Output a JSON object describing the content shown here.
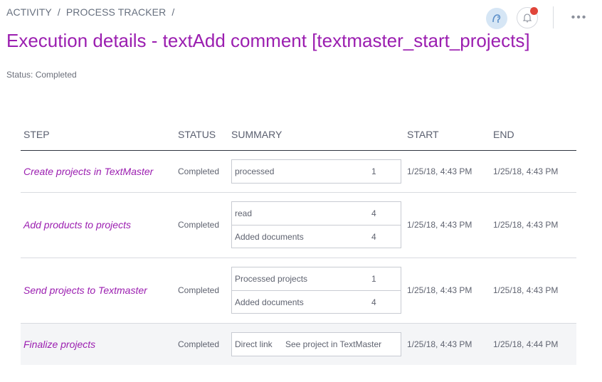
{
  "breadcrumb": {
    "items": [
      "ACTIVITY",
      "/",
      "PROCESS TRACKER",
      "/"
    ]
  },
  "page": {
    "title": "Execution details - textAdd comment [textmaster_start_projects]",
    "status_label": "Status: Completed"
  },
  "topbar": {
    "avatar_icon": "user-avatar-icon",
    "bell_icon": "bell-icon",
    "more_icon": "more-horizontal-icon",
    "more_glyph": "•••",
    "accent_color": "#9b1eb0",
    "notification_color": "#e0453a"
  },
  "table": {
    "headers": {
      "step": "STEP",
      "status": "STATUS",
      "summary": "SUMMARY",
      "start": "START",
      "end": "END"
    },
    "rows": [
      {
        "step": "Create projects in TextMaster",
        "status": "Completed",
        "summary": [
          {
            "label": "processed",
            "value": "1"
          }
        ],
        "start": "1/25/18, 4:43 PM",
        "end": "1/25/18, 4:43 PM"
      },
      {
        "step": "Add products to projects",
        "status": "Completed",
        "summary": [
          {
            "label": "read",
            "value": "4"
          },
          {
            "label": "Added documents",
            "value": "4"
          }
        ],
        "start": "1/25/18, 4:43 PM",
        "end": "1/25/18, 4:43 PM"
      },
      {
        "step": "Send projects to Textmaster",
        "status": "Completed",
        "summary": [
          {
            "label": "Processed projects",
            "value": "1"
          },
          {
            "label": "Added documents",
            "value": "4"
          }
        ],
        "start": "1/25/18, 4:43 PM",
        "end": "1/25/18, 4:43 PM"
      },
      {
        "step": "Finalize projects",
        "status": "Completed",
        "summary": [
          {
            "label": "Direct link",
            "link": "See project in TextMaster"
          }
        ],
        "start": "1/25/18, 4:43 PM",
        "end": "1/25/18, 4:44 PM"
      }
    ]
  }
}
